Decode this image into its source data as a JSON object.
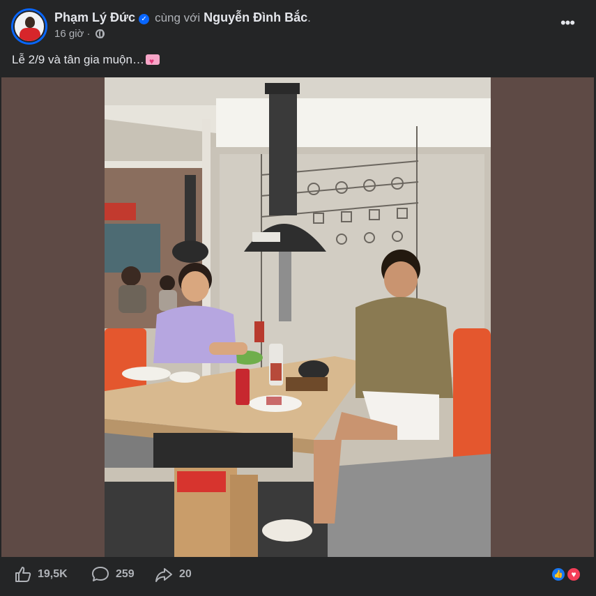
{
  "post": {
    "author": "Phạm Lý Đức",
    "with_text": "cùng với",
    "tagged": "Nguyễn Đình Bắc",
    "time": "16 giờ",
    "separator": "·",
    "caption": "Lễ 2/9 và tân gia muộn…",
    "more_label": "•••"
  },
  "photo": {
    "description_icon": "restaurant-photo",
    "accent_colors": {
      "letterbox": "#5e4a45",
      "booth_seat": "#e4572e",
      "table_wood": "#d8b98f"
    }
  },
  "footer": {
    "likes": "19,5K",
    "comments": "259",
    "shares": "20"
  },
  "colors": {
    "background": "#242526",
    "text_primary": "#e4e6eb",
    "text_secondary": "#b0b3b8",
    "verified_blue": "#0866ff",
    "like_blue": "#1877f2",
    "love_red": "#f33e58"
  }
}
